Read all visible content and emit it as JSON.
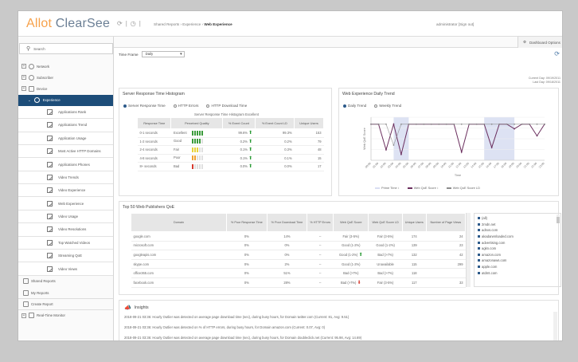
{
  "app": {
    "logo_part1": "Allot",
    "logo_part2": "ClearSee"
  },
  "header": {
    "breadcrumb_prefix": "Shared Reports › Experience ›",
    "breadcrumb_current": "Web Experience",
    "user_link": "administrator [Sign out]",
    "dashboard_options": "Dashboard Options"
  },
  "sidebar": {
    "search_label": "Search",
    "top_items": [
      {
        "label": "Network"
      },
      {
        "label": "Subscriber"
      },
      {
        "label": "Device"
      }
    ],
    "active_item": "Experience",
    "sub_items": [
      {
        "label": "Applications Rank"
      },
      {
        "label": "Applications Trend"
      },
      {
        "label": "Application Usage"
      },
      {
        "label": "Most Active HTTP Domains"
      },
      {
        "label": "Applications Phones"
      },
      {
        "label": "Video Trends"
      },
      {
        "label": "Video Experience"
      },
      {
        "label": "Web Experience"
      },
      {
        "label": "Video Usage"
      },
      {
        "label": "Video Resolutions"
      },
      {
        "label": "Top Watched Videos"
      },
      {
        "label": "Streaming QoE"
      },
      {
        "label": "Video Views"
      }
    ],
    "bottom_items": [
      {
        "label": "Shared Reports"
      },
      {
        "label": "My Reports"
      },
      {
        "label": "Create Report"
      },
      {
        "label": "Real-Time Monitor"
      }
    ]
  },
  "timeframe": {
    "label": "Time Frame",
    "value": "Daily"
  },
  "times": {
    "current_day": "Current Day: 09/19/2011",
    "last_day": "Last Day:   09/18/2011"
  },
  "histogram_panel": {
    "title": "Server Response Time Histogram",
    "radios": [
      "Server Response Time",
      "HTTP Errors",
      "HTTP Download Time"
    ],
    "caption": "Server Response Time Histogram Excellent",
    "headers": [
      "Response Time",
      "Perceived Quality",
      "% Event Count",
      "% Event Count LD",
      "Unique Users"
    ],
    "rows": [
      {
        "time": "0-1 seconds",
        "quality": "Excellent",
        "bars": 5,
        "color": "#3a9a3a",
        "count": "99.6%",
        "dir": "up",
        "ld": "99.3%",
        "users": "153"
      },
      {
        "time": "1-2 seconds",
        "quality": "Good",
        "bars": 4,
        "color": "#3a9a3a",
        "count": "0.2%",
        "dir": "up",
        "ld": "0.2%",
        "users": "79"
      },
      {
        "time": "2-4 seconds",
        "quality": "Fair",
        "bars": 3,
        "color": "#e8d23a",
        "count": "0.1%",
        "dir": "up",
        "ld": "0.3%",
        "users": "48"
      },
      {
        "time": "4-8 seconds",
        "quality": "Poor",
        "bars": 2,
        "color": "#f0a030",
        "count": "0.1%",
        "dir": "up",
        "ld": "0.1%",
        "users": "15"
      },
      {
        "time": "8+ seconds",
        "quality": "Bad",
        "bars": 1,
        "color": "#d63a2e",
        "count": "0.0%",
        "dir": "up",
        "ld": "0.0%",
        "users": "17"
      }
    ]
  },
  "trend_panel": {
    "title": "Web Experience Daily Trend",
    "options": [
      "Daily Trend",
      "Weekly Trend"
    ],
    "legend": [
      "Prime Time ↕",
      "Web QoE Score ↕",
      "Web QoE Score LD"
    ],
    "ylabel": "Web QoE Score",
    "xlabel": "Time"
  },
  "chart_data": {
    "type": "line",
    "title": "Web Experience Daily Trend",
    "xlabel": "Time",
    "ylabel": "Web QoE Score",
    "x": [
      "00:00",
      "01:00",
      "02:00",
      "03:00",
      "04:00",
      "05:00",
      "06:00",
      "07:00",
      "08:00",
      "09:00",
      "10:00",
      "11:00",
      "12:00",
      "13:00",
      "14:00",
      "15:00",
      "16:00",
      "17:00",
      "18:00",
      "19:00",
      "20:00",
      "21:00",
      "22:00",
      "23:00"
    ],
    "series": [
      {
        "name": "Web QoE Score",
        "color": "#6b2f5e",
        "values": [
          4.6,
          4.6,
          2.4,
          4.6,
          2.0,
          4.6,
          4.6,
          4.6,
          4.6,
          4.6,
          4.6,
          4.6,
          2.2,
          4.6,
          4.6,
          4.6,
          2.6,
          4.6,
          4.6,
          4.2,
          4.6,
          4.6,
          3.6,
          4.6
        ]
      },
      {
        "name": "Web QoE Score LD",
        "color": "#8c8c8c",
        "values": [
          4.6,
          4.6,
          4.6,
          2.8,
          4.6,
          4.6,
          4.6,
          4.6,
          4.6,
          4.6,
          4.6,
          4.6,
          4.6,
          4.6,
          4.6,
          4.6,
          4.6,
          4.6,
          4.6,
          4.6,
          4.6,
          4.6,
          4.6,
          4.6
        ]
      }
    ],
    "ylim": [
      1.5,
      5.2
    ]
  },
  "publishers_panel": {
    "title": "Top 50 Web Publishers QoE",
    "headers": [
      "Domain",
      "% Poor Response Time",
      "% Poor Download Time",
      "% HTTP Errors",
      "Web QoE Score",
      "Web QoE Score LD",
      "Unique Users",
      "Number of Page Views"
    ],
    "rows": [
      {
        "domain": "google.com",
        "resp": "0%",
        "dl": "14%",
        "err": "--",
        "score": "Fair (3-5%)",
        "dir": "",
        "ld": "Fair (3-5%)",
        "users": "174",
        "views": "24"
      },
      {
        "domain": "microsoft.com",
        "resp": "0%",
        "dl": "0%",
        "err": "--",
        "score": "Good (1-2%)",
        "dir": "",
        "ld": "Good (1-2%)",
        "users": "139",
        "views": "23"
      },
      {
        "domain": "googleapis.com",
        "resp": "0%",
        "dl": "0%",
        "err": "--",
        "score": "Good (1-2%)",
        "dir": "up",
        "ld": "Bad (>7%)",
        "users": "132",
        "views": "42"
      },
      {
        "domain": "skype.com",
        "resp": "0%",
        "dl": "2%",
        "err": "--",
        "score": "Good (1-2%)",
        "dir": "",
        "ld": "Unavailable",
        "users": "115",
        "views": "299"
      },
      {
        "domain": "office365.com",
        "resp": "0%",
        "dl": "51%",
        "err": "--",
        "score": "Bad (>7%)",
        "dir": "",
        "ld": "Bad (>7%)",
        "users": "118",
        "views": ""
      },
      {
        "domain": "facebook.com",
        "resp": "0%",
        "dl": "28%",
        "err": "--",
        "score": "Bad (>7%)",
        "dir": "down",
        "ld": "Fair (3-5%)",
        "users": "117",
        "views": "33"
      }
    ],
    "domains": [
      "(all)",
      "2mdn.net",
      "adnxs.com",
      "akadarwnloaded.com",
      "advertising.com",
      "agkn.com",
      "amazon.com",
      "amazonaws.com",
      "apple.com",
      "atdmt.com"
    ]
  },
  "insights": {
    "title": "Insights",
    "items": [
      "2018-09-21 03:36: Hourly Outlier was detected on average page download time (sec), during busy hours, for Domain twitter.com (Current: 81, Avg: 9.51)",
      "2018-09-21 03:36: Hourly Outlier was detected on % of HTTP errors, during busy hours, for Domain amazon.com (Current: 0.07, Avg: 0)",
      "2018-09-21 03:36: Hourly Outlier was detected on average page download time (sec), during busy hours, for Domain doubleclick.net (Current: 95.98, Avg: 14.69)"
    ]
  }
}
